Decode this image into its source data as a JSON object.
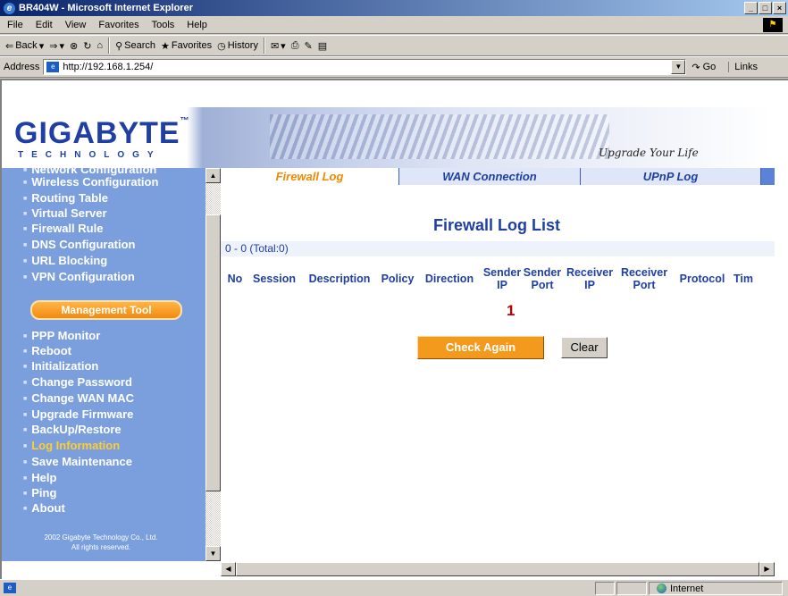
{
  "window": {
    "title": "BR404W - Microsoft Internet Explorer"
  },
  "menu": [
    "File",
    "Edit",
    "View",
    "Favorites",
    "Tools",
    "Help"
  ],
  "toolbar": {
    "back": "Back",
    "search": "Search",
    "favorites": "Favorites",
    "history": "History"
  },
  "address": {
    "label": "Address",
    "url": "http://192.168.1.254/",
    "go": "Go",
    "links": "Links"
  },
  "banner": {
    "logo": "GIGABYTE",
    "tech": "TECHNOLOGY",
    "slogan": "Upgrade Your Life"
  },
  "sidebar": {
    "items": [
      "Network Configuration",
      "Wireless Configuration",
      "Routing Table",
      "Virtual Server",
      "Firewall Rule",
      "DNS Configuration",
      "URL Blocking",
      "VPN Configuration"
    ],
    "section": "Management Tool",
    "tools": [
      "PPP Monitor",
      "Reboot",
      "Initialization",
      "Change Password",
      "Change WAN MAC",
      "Upgrade Firmware",
      "BackUp/Restore",
      "Log Information",
      "Save Maintenance",
      "Help",
      "Ping",
      "About"
    ],
    "active_tool": "Log Information",
    "copyright_line1": "2002 Gigabyte Technology Co., Ltd.",
    "copyright_line2": "All rights reserved."
  },
  "tabs": [
    {
      "label": "Firewall Log",
      "active": true
    },
    {
      "label": "WAN Connection",
      "active": false
    },
    {
      "label": "UPnP Log",
      "active": false
    }
  ],
  "main": {
    "title": "Firewall Log List",
    "total": "0 - 0 (Total:0)",
    "columns": [
      "No",
      "Session",
      "Description",
      "Policy",
      "Direction",
      "Sender IP",
      "Sender Port",
      "Receiver IP",
      "Receiver Port",
      "Protocol",
      "Tim"
    ],
    "page_number": "1",
    "check_again": "Check Again",
    "clear": "Clear"
  },
  "status": {
    "zone": "Internet"
  },
  "colors": {
    "accent": "#1f3fa3",
    "sidebar": "#7b9fdd",
    "orange": "#f39a1d",
    "active_tab": "#f08a00"
  }
}
